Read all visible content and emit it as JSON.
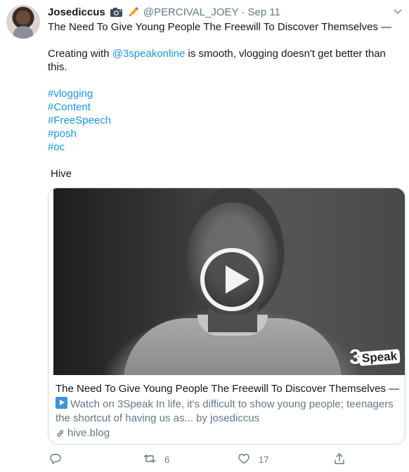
{
  "tweet": {
    "display_name": "Josediccus",
    "handle": "@PERCIVAL_JOEY",
    "separator": "·",
    "date": "Sep 11",
    "title_line": "The Need To Give Young People The Freewill To Discover Themselves —",
    "body_prefix": "Creating with ",
    "mention": "@3speakonline",
    "body_suffix": " is smooth, vlogging doesn't get better than this.",
    "hashtags": [
      "#vlogging",
      "#Content",
      "#FreeSpeech",
      "#posh",
      "#oc"
    ],
    "platform_label": "Hive"
  },
  "card": {
    "logo_digit": "3",
    "logo_word": "Speak",
    "title": "The Need To Give Young People The Freewill To Discover Themselves —...",
    "description": "Watch on 3Speak In life, it's difficult to show young people; teenagers the shortcut of having us as... by josediccus",
    "domain": "hive.blog"
  },
  "actions": {
    "reply_count": "",
    "retweet_count": "6",
    "like_count": "17"
  },
  "colors": {
    "link": "#1b95e0",
    "secondary_text": "#657786",
    "border": "#ccd6dd"
  },
  "icons": [
    "camera-icon",
    "pencil-icon",
    "chevron-down-icon",
    "play-icon",
    "link-icon",
    "reply-icon",
    "retweet-icon",
    "like-icon",
    "share-icon"
  ]
}
